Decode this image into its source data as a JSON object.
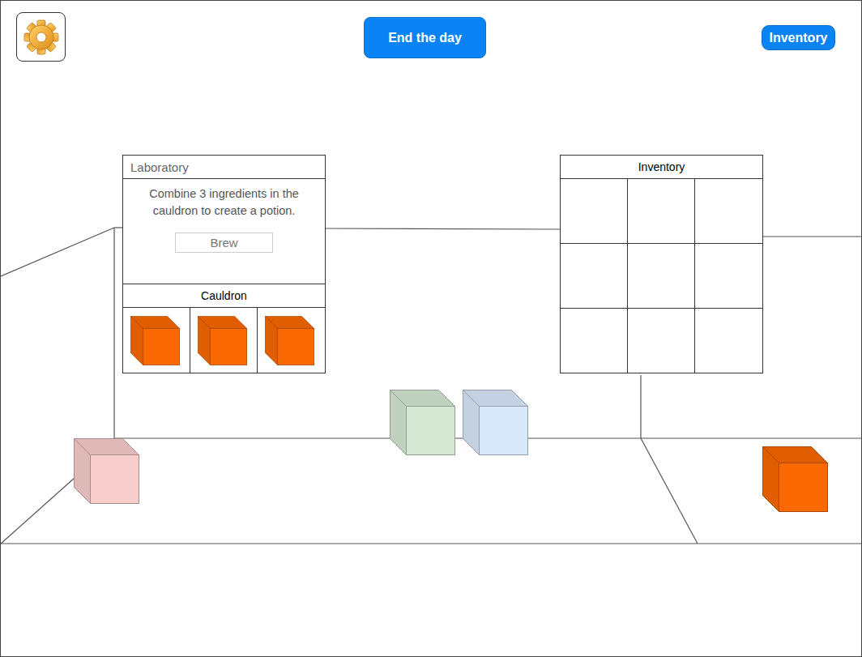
{
  "toolbar": {
    "end_day_button": "End the day",
    "inventory_button": "Inventory"
  },
  "laboratory": {
    "title": "Laboratory",
    "description": "Combine 3 ingredients in the cauldron to create a potion.",
    "brew_button": "Brew",
    "cauldron": {
      "title": "Cauldron",
      "slots": [
        {
          "filled": true,
          "color": "#fa6800"
        },
        {
          "filled": true,
          "color": "#fa6800"
        },
        {
          "filled": true,
          "color": "#fa6800"
        }
      ]
    }
  },
  "inventory": {
    "title": "Inventory",
    "slots": [
      {
        "filled": false
      },
      {
        "filled": false
      },
      {
        "filled": false
      },
      {
        "filled": false
      },
      {
        "filled": false
      },
      {
        "filled": false
      },
      {
        "filled": false
      },
      {
        "filled": false
      },
      {
        "filled": false
      }
    ]
  },
  "ingredients": [
    {
      "color": "#f8cecc"
    },
    {
      "color": "#d5e8d4"
    },
    {
      "color": "#dae8fc"
    },
    {
      "color": "#fa6800"
    }
  ]
}
